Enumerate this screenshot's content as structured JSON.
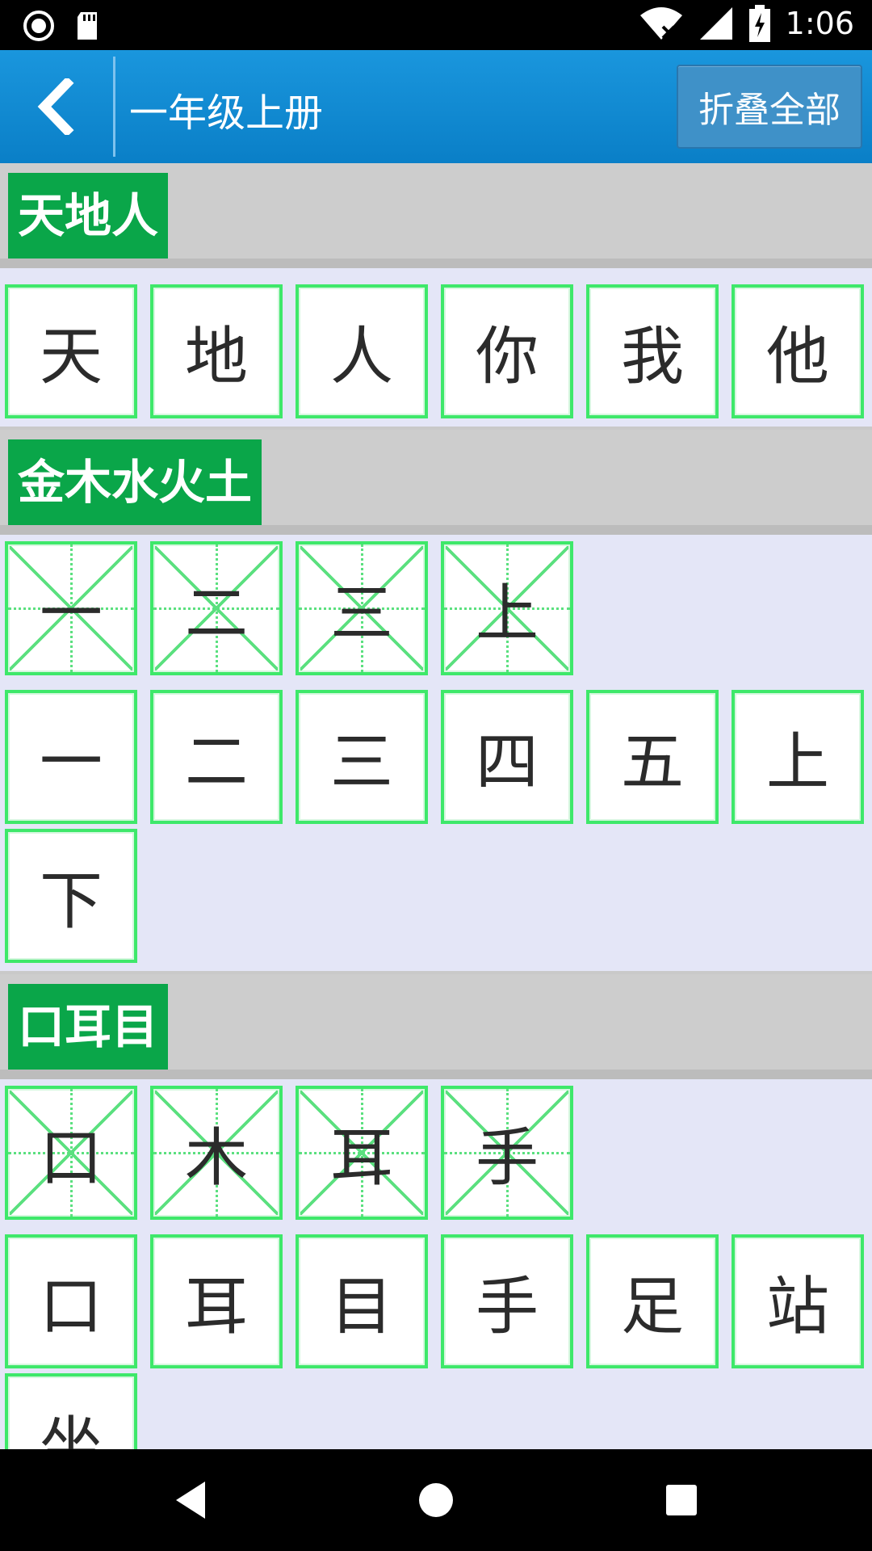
{
  "status_bar": {
    "time": "1:06",
    "icons": [
      "record-icon",
      "sd-card-icon",
      "wifi-icon",
      "signal-icon",
      "battery-charging-icon"
    ]
  },
  "app_bar": {
    "back_icon": "chevron-left-icon",
    "title": "一年级上册",
    "collapse_label": "折叠全部"
  },
  "lessons": [
    {
      "title": "天地人",
      "mizi": [],
      "chars": [
        "天",
        "地",
        "人",
        "你",
        "我",
        "他"
      ]
    },
    {
      "title": "金木水火土",
      "mizi": [
        "一",
        "二",
        "三",
        "上"
      ],
      "chars": [
        "一",
        "二",
        "三",
        "四",
        "五",
        "上",
        "下"
      ]
    },
    {
      "title": "口耳目",
      "mizi": [
        "口",
        "木",
        "耳",
        "手"
      ],
      "chars": [
        "口",
        "耳",
        "目",
        "手",
        "足",
        "站",
        "坐"
      ]
    }
  ],
  "nav_bar": {
    "icons": [
      "back-triangle-icon",
      "home-circle-icon",
      "recents-square-icon"
    ]
  },
  "colors": {
    "app_bar": "#0a7fc7",
    "lesson_label_bg": "#0aa649",
    "cell_border": "#3ee86a",
    "content_bg": "#e4e6f7"
  }
}
